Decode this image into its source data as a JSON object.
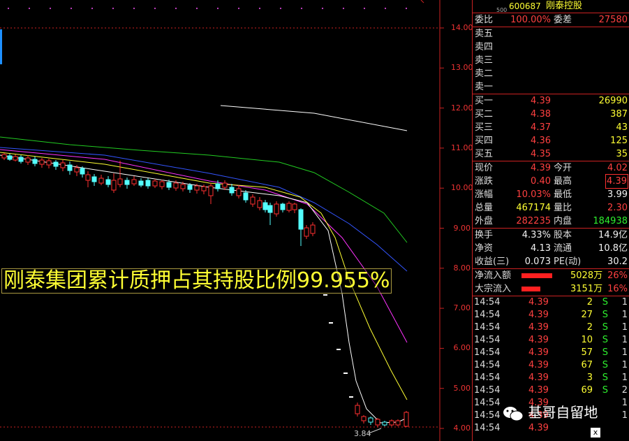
{
  "chart": {
    "y_axis_labels": [
      "14.00",
      "13.00",
      "12.00",
      "11.00",
      "10.00",
      "9.00",
      "8.00",
      "7.00",
      "6.00",
      "5.00",
      "4.00"
    ],
    "low_price_label": "3.84",
    "banner": "刚泰集团累计质押占其持股比例99.955%",
    "colors": {
      "up": "#ff3030",
      "down": "#54ffff",
      "ma5": "#ffffff",
      "ma10": "#ffff33",
      "ma20": "#ff33ff",
      "ma30": "#3355ff",
      "ma60": "#22cc22",
      "ma120": "#ffffff",
      "axis": "#cc2222"
    }
  },
  "stock": {
    "exchange": "500",
    "code": "600687",
    "name": "刚泰控股"
  },
  "order_book": {
    "weibi_label": "委比",
    "weibi_value": "100.00%",
    "weicha_label": "委差",
    "weicha_value": "27580",
    "asks": [
      {
        "label": "卖五"
      },
      {
        "label": "卖四"
      },
      {
        "label": "卖三"
      },
      {
        "label": "卖二"
      },
      {
        "label": "卖一"
      }
    ],
    "bids": [
      {
        "label": "买一",
        "price": "4.39",
        "vol": "26990"
      },
      {
        "label": "买二",
        "price": "4.38",
        "vol": "387"
      },
      {
        "label": "买三",
        "price": "4.37",
        "vol": "43"
      },
      {
        "label": "买四",
        "price": "4.36",
        "vol": "125"
      },
      {
        "label": "买五",
        "price": "4.35",
        "vol": "35"
      }
    ]
  },
  "quote": [
    {
      "l1": "现价",
      "v1": "4.39",
      "l2": "今开",
      "v2": "4.02"
    },
    {
      "l1": "涨跌",
      "v1": "0.40",
      "l2": "最高",
      "v2": "4.39"
    },
    {
      "l1": "涨幅",
      "v1": "10.03%",
      "l2": "最低",
      "v2": "3.99"
    },
    {
      "l1": "总量",
      "v1": "467174",
      "l2": "量比",
      "v2": "2.30"
    },
    {
      "l1": "外盘",
      "v1": "282235",
      "l2": "内盘",
      "v2": "184938"
    }
  ],
  "fund": [
    {
      "l1": "换手",
      "v1": "4.33%",
      "l2": "股本",
      "v2": "14.9亿"
    },
    {
      "l1": "净资",
      "v1": "4.13",
      "l2": "流通",
      "v2": "10.8亿"
    },
    {
      "l1": "收益(三)",
      "v1": "0.073",
      "l2": "PE(动)",
      "v2": "30.2"
    }
  ],
  "flow": [
    {
      "label": "净流入额",
      "value": "5028万",
      "pct": "26%",
      "bar": 0.26
    },
    {
      "label": "大宗流入",
      "value": "3151万",
      "pct": "16%",
      "bar": 0.16
    }
  ],
  "ticks": [
    {
      "time": "14:54",
      "price": "4.39",
      "vol": "2",
      "side": "S",
      "n": "1"
    },
    {
      "time": "14:54",
      "price": "4.39",
      "vol": "27",
      "side": "S",
      "n": "1"
    },
    {
      "time": "14:54",
      "price": "4.39",
      "vol": "2",
      "side": "S",
      "n": "1"
    },
    {
      "time": "14:54",
      "price": "4.39",
      "vol": "10",
      "side": "S",
      "n": "1"
    },
    {
      "time": "14:54",
      "price": "4.39",
      "vol": "57",
      "side": "S",
      "n": "1"
    },
    {
      "time": "14:54",
      "price": "4.39",
      "vol": "67",
      "side": "S",
      "n": "1"
    },
    {
      "time": "14:54",
      "price": "4.39",
      "vol": "3",
      "side": "S",
      "n": "1"
    },
    {
      "time": "14:54",
      "price": "4.39",
      "vol": "69",
      "side": "S",
      "n": "2"
    },
    {
      "time": "14:54",
      "price": "4.39",
      "vol": "",
      "side": "",
      "n": "1"
    },
    {
      "time": "14:54",
      "price": "4.39",
      "vol": "",
      "side": "",
      "n": "1"
    },
    {
      "time": "14:54",
      "price": "4.39",
      "vol": "",
      "side": "",
      "n": ""
    }
  ],
  "watermark": {
    "text": "基哥自留地",
    "close": "x"
  }
}
